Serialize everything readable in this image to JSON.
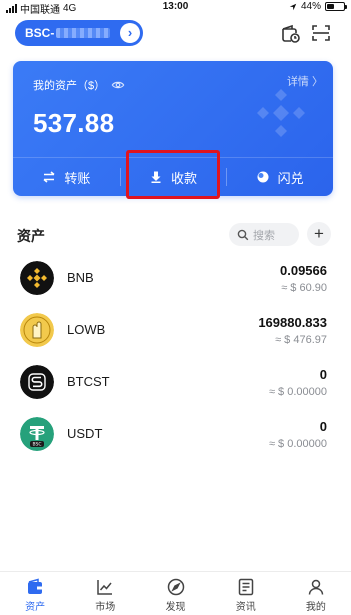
{
  "status_bar": {
    "carrier": "中国联通",
    "network": "4G",
    "time": "13:00",
    "battery_text": "44%",
    "battery_level": 0.44
  },
  "header": {
    "wallet_name": "BSC-",
    "icons": [
      "wallet-clock-icon",
      "scan-icon"
    ]
  },
  "asset_card": {
    "label": "我的资产（$）",
    "detail": "详情 〉",
    "total": "537.88",
    "actions": [
      {
        "label": "转账",
        "icon": "transfer-icon"
      },
      {
        "label": "收款",
        "icon": "receive-icon"
      },
      {
        "label": "闪兑",
        "icon": "swap-icon"
      }
    ]
  },
  "assets": {
    "title": "资产",
    "search_placeholder": "搜索",
    "add_symbol": "+",
    "items": [
      {
        "name": "BNB",
        "amount": "0.09566",
        "value": "≈ $ 60.90",
        "icon": "bnb-icon"
      },
      {
        "name": "LOWB",
        "amount": "169880.833",
        "value": "≈ $ 476.97",
        "icon": "lowb-icon"
      },
      {
        "name": "BTCST",
        "amount": "0",
        "value": "≈ $ 0.00000",
        "icon": "btcst-icon"
      },
      {
        "name": "USDT",
        "amount": "0",
        "value": "≈ $ 0.00000",
        "icon": "usdt-icon"
      }
    ]
  },
  "bottom_nav": {
    "items": [
      {
        "label": "资产",
        "icon": "wallet-icon",
        "active": true
      },
      {
        "label": "市场",
        "icon": "chart-icon",
        "active": false
      },
      {
        "label": "发现",
        "icon": "compass-icon",
        "active": false
      },
      {
        "label": "资讯",
        "icon": "news-icon",
        "active": false
      },
      {
        "label": "我的",
        "icon": "person-icon",
        "active": false
      }
    ]
  },
  "colors": {
    "accent": "#2f6bf0",
    "highlight": "#e0141e",
    "bnb": "#f3ba2f",
    "lowb": "#f2c94c",
    "usdt": "#26a17b"
  }
}
